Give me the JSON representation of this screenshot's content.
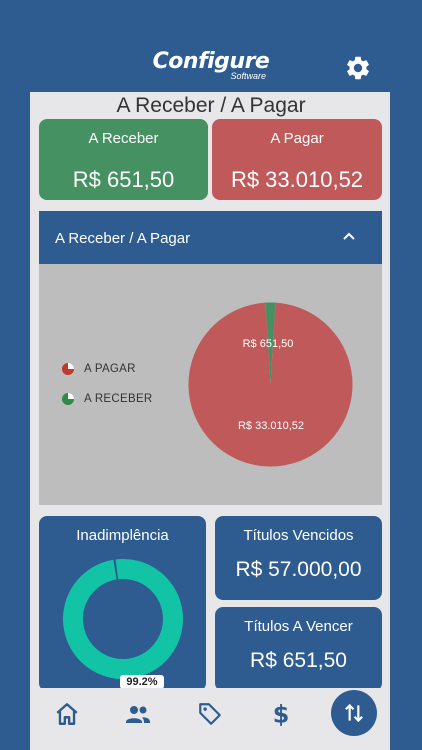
{
  "header": {
    "logo_main": "Configure",
    "logo_sub": "Software"
  },
  "page": {
    "title": "A Receber / A Pagar"
  },
  "summary": {
    "receber": {
      "label": "A Receber",
      "value": "R$ 651,50"
    },
    "pagar": {
      "label": "A Pagar",
      "value": "R$ 33.010,52"
    }
  },
  "chart_section": {
    "title": "A Receber / A Pagar",
    "legend": [
      "A PAGAR",
      "A RECEBER"
    ],
    "slice_labels": [
      "R$ 651,50",
      "R$ 33.010,52"
    ]
  },
  "chart_data": {
    "type": "pie",
    "categories": [
      "A PAGAR",
      "A RECEBER"
    ],
    "values": [
      33010.52,
      651.5
    ],
    "colors": [
      "#c05a5a",
      "#469162"
    ]
  },
  "inadimplencia": {
    "label": "Inadimplência",
    "percent_label": "99.2%",
    "percent": 99.2,
    "color": "#12c4a5"
  },
  "titulos_vencidos": {
    "label": "Títulos Vencidos",
    "value": "R$ 57.000,00"
  },
  "titulos_a_vencer": {
    "label": "Títulos A Vencer",
    "value": "R$ 651,50"
  },
  "nav": [
    "home-icon",
    "users-icon",
    "tag-icon",
    "dollar-icon",
    "transfer-icon"
  ],
  "colors": {
    "brand_blue": "#2e5c91",
    "green": "#469162",
    "red": "#c05a5a"
  }
}
